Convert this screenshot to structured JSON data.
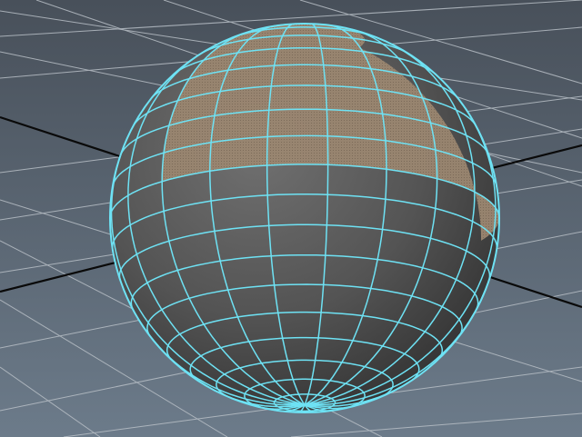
{
  "viewport": {
    "background_top": "#48505a",
    "background_bottom": "#6c7b8a",
    "grid_line_color": "#b8bfc6",
    "axis_line_color": "#0a0a0a",
    "wireframe_color": "#6ee2f4",
    "sphere_shade_color": "#555555",
    "selected_faces_color": "#9a8670"
  },
  "scene": {
    "object_type": "polygon-sphere",
    "wireframe_highlighted": true,
    "face_selection": "upper-front-faces"
  }
}
